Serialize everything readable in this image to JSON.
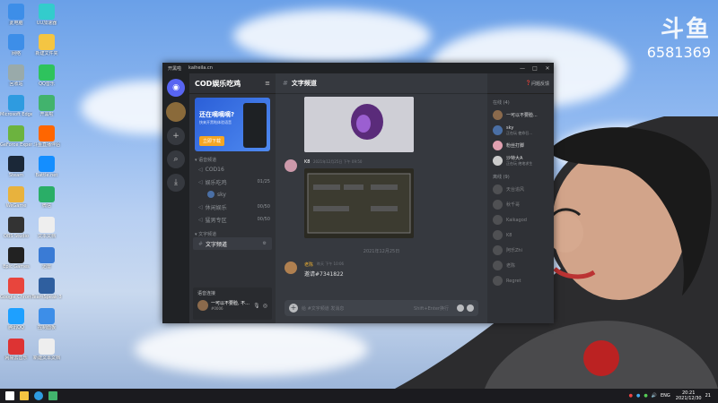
{
  "stream": {
    "logo": "斗鱼",
    "room_number": "6581369"
  },
  "desktop_icons": [
    {
      "label": "此电脑",
      "color": "#3d8ee8"
    },
    {
      "label": "网络",
      "color": "#3d8ee8"
    },
    {
      "label": "回收站",
      "color": "#9aa"
    },
    {
      "label": "Microsoft Edge",
      "color": "#2e9be0"
    },
    {
      "label": "GeForce Experience",
      "color": "#6cb33f"
    },
    {
      "label": "Steam",
      "color": "#1b2838"
    },
    {
      "label": "WeGame",
      "color": "#e8b23d"
    },
    {
      "label": "OBS Studio",
      "color": "#333"
    },
    {
      "label": "Epic Games",
      "color": "#222"
    },
    {
      "label": "Google Chrome",
      "color": "#e8453d"
    },
    {
      "label": "腾讯QQ",
      "color": "#1ea0ff"
    },
    {
      "label": "网易云音乐",
      "color": "#d33"
    },
    {
      "label": "UU加速器",
      "color": "#3cc"
    },
    {
      "label": "新建文件夹",
      "color": "#f4c542"
    },
    {
      "label": "QQ音乐",
      "color": "#2ec35d"
    },
    {
      "label": "开黑啦",
      "color": "#42b36d"
    },
    {
      "label": "斗鱼直播伴侣",
      "color": "#f60"
    },
    {
      "label": "Battle.net",
      "color": "#148eff"
    },
    {
      "label": "微信",
      "color": "#2aae67"
    },
    {
      "label": "文本文档",
      "color": "#eee"
    },
    {
      "label": "迅雷",
      "color": "#3a7bd5"
    },
    {
      "label": "TeamSpeak 3",
      "color": "#2f5f9f"
    },
    {
      "label": "控制面板",
      "color": "#3d8ee8"
    },
    {
      "label": "新建文本文档",
      "color": "#eee"
    }
  ],
  "window": {
    "app_title": "开黑啦",
    "url": "kaiheila.cn",
    "controls": {
      "minimize": "—",
      "maximize": "□",
      "close": "✕"
    }
  },
  "server": {
    "name": "COD娱乐吃鸡",
    "banner": {
      "headline": "还在嘀嘀嘀?",
      "subline": "快来开黑啦体验语音",
      "cta": "立即下载"
    }
  },
  "channel_list": {
    "voice_category": "语音频道",
    "voice_channels": [
      {
        "name": "COD16",
        "count": ""
      },
      {
        "name": "娱乐吃鸡",
        "count": "01/25"
      },
      {
        "name": "休闲娱乐",
        "count": "00/50"
      },
      {
        "name": "猛男专区",
        "count": "00/50"
      }
    ],
    "voice_user": "sky",
    "text_category": "文字频道",
    "text_channels": [
      {
        "name": "文字频道"
      }
    ]
  },
  "user_panel": {
    "status": "语音连接",
    "name": "一可以不要脸, 不...",
    "id": "#0006"
  },
  "chat": {
    "channel_title": "文字频道",
    "header_action": "问题反馈",
    "message1": {
      "author": "K8",
      "time": "2021年12月25日 下午 09:50"
    },
    "date_divider": "2021年12月25日",
    "message2": {
      "author": "老陈",
      "time": "昨天 下午 10:06",
      "text": "邀请#7341822"
    },
    "composer_placeholder": "给 #文字频道 发消息",
    "composer_hint": "Shift+Enter换行"
  },
  "members": {
    "online_label": "在线 (4)",
    "online": [
      {
        "name": "一可以不要脸...",
        "sub": "",
        "color": "#8b6a4c"
      },
      {
        "name": "sky",
        "sub": "正在玩 使命召...",
        "color": "#4a6fa5"
      },
      {
        "name": "粉丝打脚",
        "sub": "",
        "color": "#e0a0b0"
      },
      {
        "name": "沙特大A",
        "sub": "正在玩 绝地求生",
        "color": "#ccc"
      }
    ],
    "offline_label": "离线 (9)",
    "offline": [
      {
        "name": "天台追风",
        "color": "#777"
      },
      {
        "name": "秋千哥",
        "color": "#777"
      },
      {
        "name": "Kaikagod",
        "color": "#777"
      },
      {
        "name": "K8",
        "color": "#777"
      },
      {
        "name": "阿乐Zhi",
        "color": "#777"
      },
      {
        "name": "老陈",
        "color": "#777"
      },
      {
        "name": "Regret",
        "color": "#777"
      }
    ]
  },
  "taskbar": {
    "lang": "ENG",
    "time": "20:21",
    "date": "2021/12/30",
    "notification_count": "21"
  }
}
